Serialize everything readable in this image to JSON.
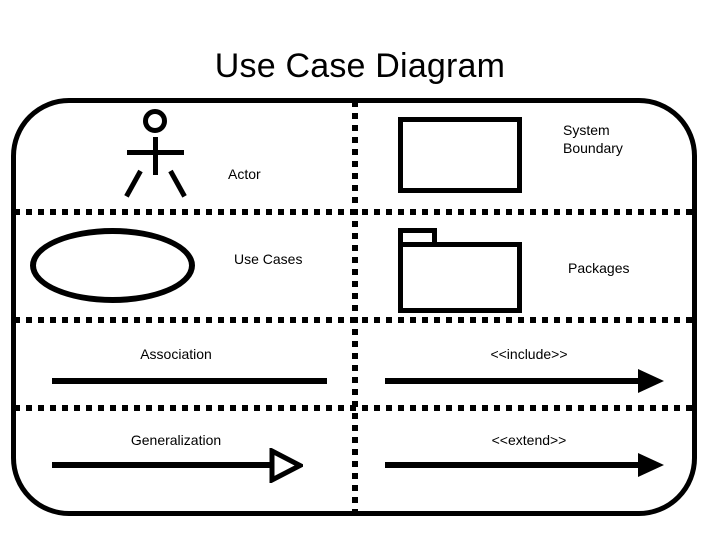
{
  "diagram": {
    "title": "Use Case Diagram",
    "boundary_shape": "rounded-rectangle",
    "stroke_color": "#000000",
    "background_color": "#ffffff",
    "divider_style": "dotted",
    "columns": 2,
    "rows": 4
  },
  "cells": {
    "actor": {
      "label": "Actor",
      "symbol": "stick-figure"
    },
    "system_boundary": {
      "label": "System\nBoundary",
      "symbol": "rectangle"
    },
    "use_cases": {
      "label": "Use Cases",
      "symbol": "ellipse"
    },
    "packages": {
      "label": "Packages",
      "symbol": "folder"
    },
    "association": {
      "label": "Association",
      "symbol": "plain-line"
    },
    "include": {
      "label": "<<include>>",
      "symbol": "solid-arrow"
    },
    "generalization": {
      "label": "Generalization",
      "symbol": "hollow-triangle-arrow"
    },
    "extend": {
      "label": "<<extend>>",
      "symbol": "solid-arrow"
    }
  }
}
